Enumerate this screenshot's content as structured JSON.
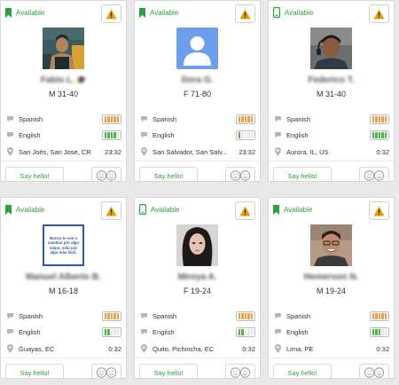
{
  "cards": [
    {
      "status_label": "Available",
      "status_icon": "bookmark-icon",
      "name": "Fabio L.",
      "name_badge": "graduation-cap-icon",
      "age_label": "M 31-40",
      "languages": [
        {
          "name": "Spanish",
          "level": 5,
          "color": "orange"
        },
        {
          "name": "English",
          "level": 4,
          "color": "green"
        }
      ],
      "location": "San Joés, San Jose, CR",
      "time": "23:32",
      "say_hello_label": "Say hello!",
      "photo": "man-dark-hair-gym-photo"
    },
    {
      "status_label": "Available",
      "status_icon": "bookmark-icon",
      "name": "Dora G.",
      "name_badge": "",
      "age_label": "F 71-80",
      "languages": [
        {
          "name": "Spanish",
          "level": 5,
          "color": "orange"
        },
        {
          "name": "English",
          "level": 1,
          "color": "green"
        }
      ],
      "location": "San Salvador, San Salv...",
      "time": "23:32",
      "say_hello_label": "Say hello!",
      "photo": "default-avatar"
    },
    {
      "status_label": "Available",
      "status_icon": "mobile-phone-icon",
      "name": "Federico T.",
      "name_badge": "",
      "age_label": "M 31-40",
      "languages": [
        {
          "name": "Spanish",
          "level": 5,
          "color": "orange"
        },
        {
          "name": "English",
          "level": 5,
          "color": "green"
        }
      ],
      "location": "Aurora, IL, US",
      "time": "0:32",
      "say_hello_label": "Say hello!",
      "photo": "man-headset-photo"
    },
    {
      "status_label": "Available",
      "status_icon": "bookmark-icon",
      "name": "Manuel Alberto B.",
      "name_badge": "",
      "age_label": "M 16-18",
      "languages": [
        {
          "name": "Spanish",
          "level": 5,
          "color": "orange"
        },
        {
          "name": "English",
          "level": 2,
          "color": "green"
        }
      ],
      "location": "Guayas, EC",
      "time": "0:32",
      "say_hello_label": "Say hello!",
      "photo": "quote-image",
      "photo_text": "Nunca te ven a cambiar por algo mejor, sólo por algo más fácil."
    },
    {
      "status_label": "Available",
      "status_icon": "mobile-phone-icon",
      "name": "Mireya A.",
      "name_badge": "",
      "age_label": "F 19-24",
      "languages": [
        {
          "name": "Spanish",
          "level": 5,
          "color": "orange"
        },
        {
          "name": "English",
          "level": 2,
          "color": "green"
        }
      ],
      "location": "Quito, Pichincha, EC",
      "time": "0:32",
      "say_hello_label": "Say hello!",
      "photo": "woman-dark-hair-photo"
    },
    {
      "status_label": "Available",
      "status_icon": "bookmark-icon",
      "name": "Hemerson N.",
      "name_badge": "",
      "age_label": "M 19-24",
      "languages": [
        {
          "name": "Spanish",
          "level": 5,
          "color": "orange"
        },
        {
          "name": "English",
          "level": 3,
          "color": "green"
        }
      ],
      "location": "Lima, PE",
      "time": "0:32",
      "say_hello_label": "Say hello!",
      "photo": "man-smiling-photo"
    }
  ],
  "colors": {
    "available": "#2aa13a",
    "warning": "#e8a000",
    "level_orange": "#f0a044",
    "level_green": "#4fb64f",
    "avatar_blue": "#6d9eeb"
  }
}
